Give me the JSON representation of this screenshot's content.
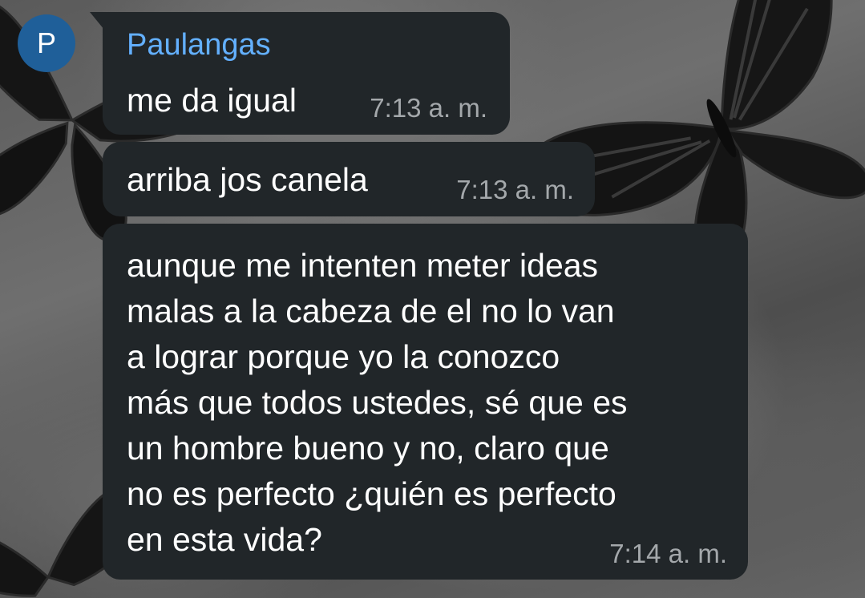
{
  "avatar": {
    "initial": "P",
    "color": "#1f5f99"
  },
  "messages": [
    {
      "sender": "Paulangas",
      "text": "me da igual",
      "time": "7:13 a. m."
    },
    {
      "text": "arriba jos canela",
      "time": "7:13 a. m."
    },
    {
      "text": "aunque me intenten meter ideas\nmalas a la cabeza de el no lo van\na lograr porque yo la conozco\nmás que todos ustedes, sé que es\nun hombre bueno y no, claro que\nno es perfecto ¿quién es perfecto\nen esta vida?",
      "time": "7:14 a. m."
    }
  ],
  "colors": {
    "bubble": "#212629",
    "sender_name": "#63b0ff",
    "timestamp": "#a4a8ab",
    "text": "#ffffff"
  },
  "wallpaper": {
    "icons": [
      "butterfly-icon",
      "butterfly-icon",
      "butterfly-icon"
    ]
  }
}
